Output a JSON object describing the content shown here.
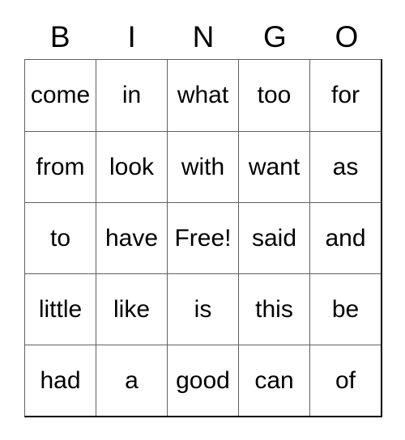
{
  "card": {
    "title_letters": [
      "B",
      "I",
      "N",
      "G",
      "O"
    ],
    "free_space_label": "Free!",
    "grid": {
      "columns": 5,
      "rows": 5,
      "cells": [
        [
          "come",
          "in",
          "what",
          "too",
          "for"
        ],
        [
          "from",
          "look",
          "with",
          "want",
          "as"
        ],
        [
          "to",
          "have",
          "Free!",
          "said",
          "and"
        ],
        [
          "little",
          "like",
          "is",
          "this",
          "be"
        ],
        [
          "had",
          "a",
          "good",
          "can",
          "of"
        ]
      ]
    },
    "colors": {
      "background": "#ffffff",
      "text": "#000000",
      "grid_line": "#606060",
      "outer_border": "#000000"
    }
  }
}
